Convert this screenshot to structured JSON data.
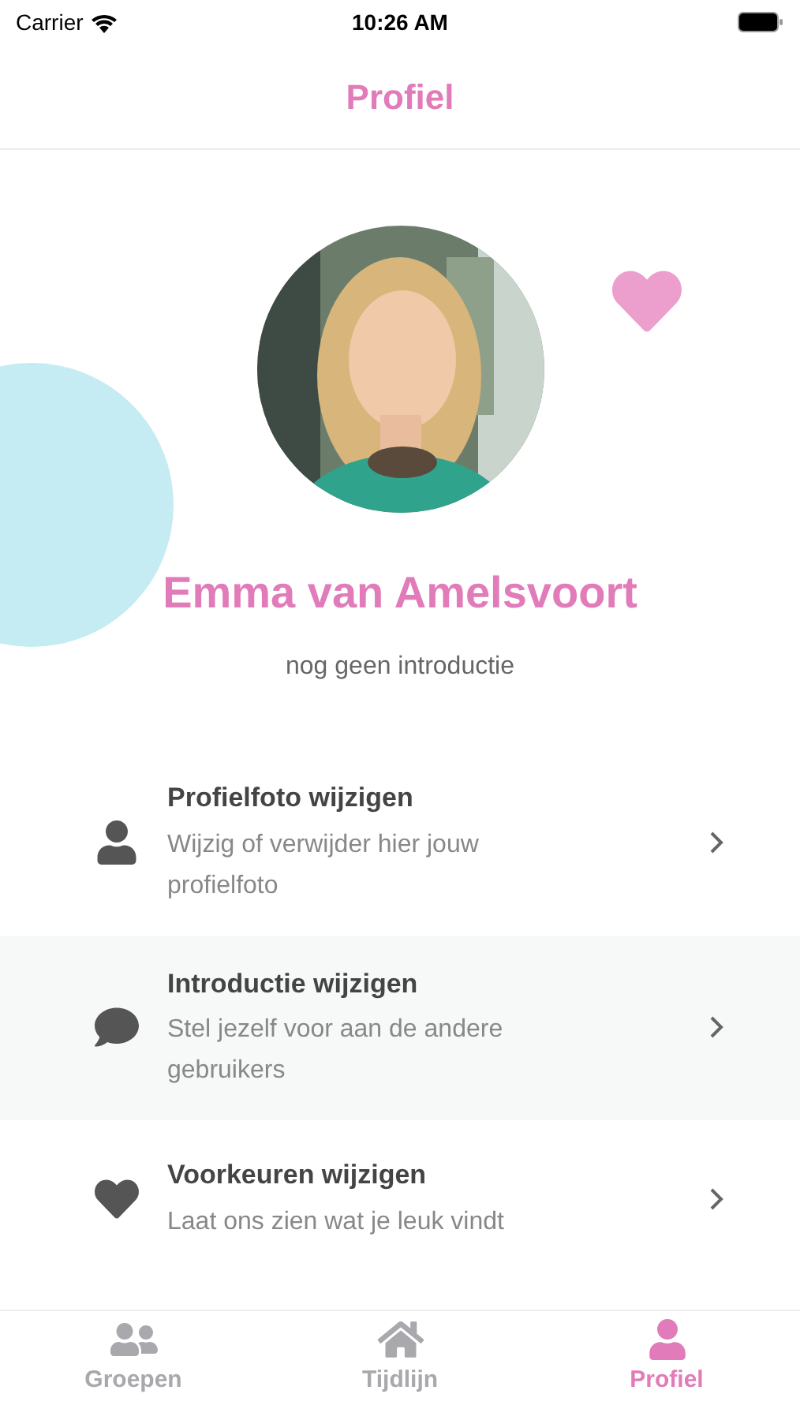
{
  "status_bar": {
    "carrier": "Carrier",
    "time": "10:26 AM"
  },
  "header": {
    "title": "Profiel"
  },
  "profile": {
    "name": "Emma van Amelsvoort",
    "intro": "nog geen introductie"
  },
  "menu": [
    {
      "title": "Profielfoto wijzigen",
      "subtitle": "Wijzig of verwijder hier jouw profielfoto"
    },
    {
      "title": "Introductie wijzigen",
      "subtitle": "Stel jezelf voor aan de andere gebruikers"
    },
    {
      "title": "Voorkeuren wijzigen",
      "subtitle": "Laat ons zien wat je leuk vindt"
    }
  ],
  "tabs": [
    {
      "label": "Groepen",
      "selected": false
    },
    {
      "label": "Tijdlijn",
      "selected": false
    },
    {
      "label": "Profiel",
      "selected": true
    }
  ]
}
